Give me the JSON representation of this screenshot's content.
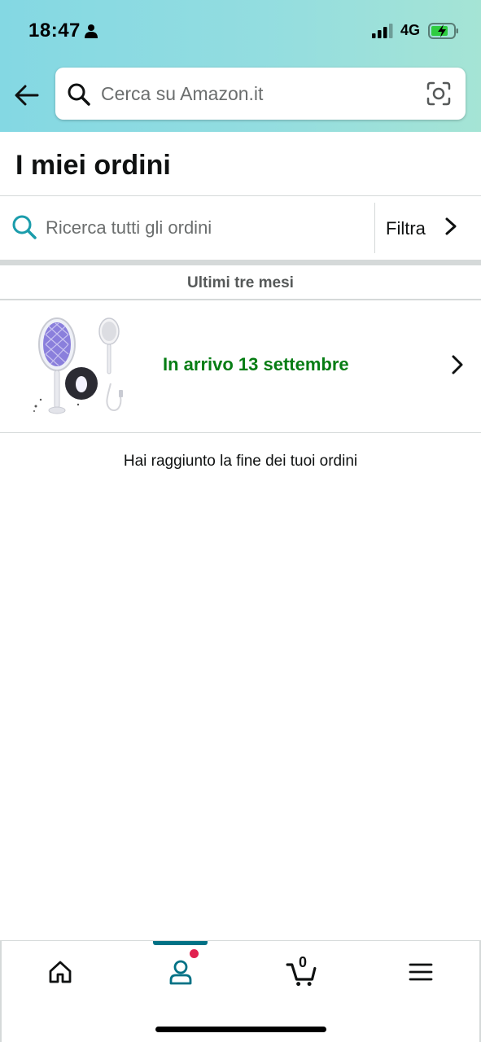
{
  "status_bar": {
    "time": "18:47",
    "network": "4G",
    "icons": [
      "person-icon",
      "signal-bars-icon",
      "battery-charging-icon"
    ]
  },
  "header": {
    "back_icon": "back-arrow-icon",
    "search": {
      "placeholder": "Cerca su Amazon.it",
      "value": "",
      "icons": [
        "search-icon",
        "camera-scan-icon"
      ]
    }
  },
  "page": {
    "title": "I miei ordini",
    "order_search": {
      "placeholder": "Ricerca tutti gli ordini",
      "value": ""
    },
    "filter_label": "Filtra",
    "section_header": "Ultimi tre mesi",
    "orders": [
      {
        "image": "electric-fly-swatter-product-image",
        "status": "In arrivo 13 settembre"
      }
    ],
    "end_message": "Hai raggiunto la fine dei tuoi ordini"
  },
  "tab_bar": {
    "tabs": [
      {
        "name": "home",
        "icon": "home-icon"
      },
      {
        "name": "account",
        "icon": "account-icon",
        "active": true,
        "notification_dot": true
      },
      {
        "name": "cart",
        "icon": "cart-icon",
        "count": "0"
      },
      {
        "name": "menu",
        "icon": "menu-icon"
      }
    ]
  },
  "colors": {
    "header_gradient_start": "#84d8e3",
    "header_gradient_end": "#a5e4d5",
    "delivery_status": "#067d14",
    "accent_teal": "#007185",
    "notification": "#e1214f",
    "divider": "#d5d9d9"
  }
}
